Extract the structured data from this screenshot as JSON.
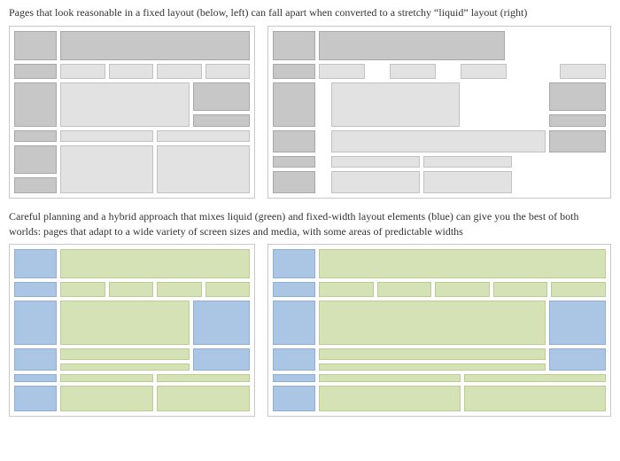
{
  "caption_top": "Pages that look reasonable in a fixed layout (below, left) can fall apart when converted to a stretchy “liquid” layout (right)",
  "caption_bottom": "Careful planning and a hybrid approach that mixes liquid (green) and fixed-width layout elements (blue) can give you the best of both worlds: pages that adapt to a wide variety of screen sizes and media, with some areas of predictable widths",
  "colors": {
    "grey_dark": "#c7c7c7",
    "grey_light": "#e2e2e2",
    "blue": "#aac6e4",
    "green": "#d5e2b6",
    "panel_border": "#c8c8c8"
  },
  "chart_data": [
    {
      "id": "fixed-grey",
      "type": "layout-diagram",
      "title": "Fixed layout (grey)",
      "width_class": "narrow",
      "rows": [
        [
          {
            "c": "gd",
            "w": 1
          },
          {
            "c": "gd",
            "w": 4
          }
        ],
        [
          {
            "c": "gd",
            "w": 1.2
          },
          {
            "c": "gl",
            "w": 1
          },
          {
            "c": "gl",
            "w": 1
          },
          {
            "c": "gl",
            "w": 1
          },
          {
            "c": "gl",
            "w": 1
          }
        ],
        [
          {
            "c": "gd",
            "w": 1.2
          },
          {
            "c": "gl",
            "w": 3,
            "h": "tall"
          },
          {
            "c": "gd",
            "w": 1.5,
            "h": "tall"
          }
        ],
        [
          {
            "c": "gd",
            "w": 1.2
          },
          {
            "c": "gl",
            "w": 3
          },
          {
            "c": "gd",
            "w": 1.5
          }
        ],
        [
          {
            "c": "gd",
            "w": 1.2
          },
          {
            "c": "gl",
            "w": 2
          },
          {
            "c": "gl",
            "w": 2
          }
        ],
        [
          {
            "c": "gd",
            "w": 1.2
          },
          {
            "c": "gl",
            "w": 2,
            "h": "tall"
          },
          {
            "c": "gl",
            "w": 2,
            "h": "tall"
          }
        ]
      ]
    },
    {
      "id": "liquid-grey",
      "type": "layout-diagram",
      "title": "Liquid layout falling apart (grey)",
      "width_class": "wide",
      "rows": [
        [
          {
            "c": "gd",
            "w": 1
          },
          {
            "c": "gd",
            "w": 4
          },
          {
            "c": "wh",
            "w": 1.5
          }
        ],
        [
          {
            "c": "gd",
            "w": 1
          },
          {
            "c": "gl",
            "w": 1
          },
          {
            "c": "wh",
            "w": 0.6
          },
          {
            "c": "gl",
            "w": 1
          },
          {
            "c": "wh",
            "w": 0.6
          },
          {
            "c": "gl",
            "w": 1
          },
          {
            "c": "wh",
            "w": 0.6
          },
          {
            "c": "gl",
            "w": 1
          }
        ],
        [
          {
            "c": "gd",
            "w": 1
          },
          {
            "c": "wh",
            "w": 0.3
          },
          {
            "c": "gl",
            "w": 3,
            "h": "tall"
          },
          {
            "c": "wh",
            "w": 2.3
          },
          {
            "c": "gd",
            "w": 1.5,
            "h": "tall"
          }
        ],
        [
          {
            "c": "gd",
            "w": 1
          },
          {
            "c": "wh",
            "w": 0.3
          },
          {
            "c": "gl",
            "w": 5
          },
          {
            "c": "gd",
            "w": 1.5
          }
        ],
        [
          {
            "c": "gd",
            "w": 1
          },
          {
            "c": "wh",
            "w": 0.3
          },
          {
            "c": "gl",
            "w": 2
          },
          {
            "c": "gl",
            "w": 2
          },
          {
            "c": "wh",
            "w": 2.3
          }
        ],
        [
          {
            "c": "gd",
            "w": 1
          },
          {
            "c": "wh",
            "w": 0.3
          },
          {
            "c": "gl",
            "w": 2
          },
          {
            "c": "gl",
            "w": 2
          },
          {
            "c": "wh",
            "w": 2.3
          }
        ]
      ]
    },
    {
      "id": "hybrid-narrow",
      "type": "layout-diagram",
      "title": "Hybrid layout narrow (blue fixed, green liquid)",
      "width_class": "narrow",
      "rows": [
        [
          {
            "c": "bl",
            "w": 1
          },
          {
            "c": "gr",
            "w": 4
          }
        ],
        [
          {
            "c": "bl",
            "w": 1
          },
          {
            "c": "gr",
            "w": 1
          },
          {
            "c": "gr",
            "w": 1
          },
          {
            "c": "gr",
            "w": 1
          },
          {
            "c": "gr",
            "w": 1
          }
        ],
        [
          {
            "c": "bl",
            "w": 1
          },
          {
            "c": "gr",
            "w": 2.5,
            "h": "tall"
          },
          {
            "c": "bl",
            "w": 1.5,
            "h": "tall"
          }
        ],
        [
          {
            "c": "bl",
            "w": 1
          },
          {
            "c": "gr",
            "w": 2.5
          },
          {
            "c": "bl",
            "w": 1.5
          }
        ],
        [
          {
            "c": "bl",
            "w": 1
          },
          {
            "c": "gr",
            "w": 2
          },
          {
            "c": "gr",
            "w": 2
          }
        ],
        [
          {
            "c": "bl",
            "w": 1
          },
          {
            "c": "gr",
            "w": 2
          },
          {
            "c": "gr",
            "w": 2
          }
        ]
      ]
    },
    {
      "id": "hybrid-wide",
      "type": "layout-diagram",
      "title": "Hybrid layout wide (blue fixed, green liquid)",
      "width_class": "wide",
      "rows": [
        [
          {
            "c": "bl",
            "w": 1
          },
          {
            "c": "gr",
            "w": 6
          }
        ],
        [
          {
            "c": "bl",
            "w": 1
          },
          {
            "c": "gr",
            "w": 1
          },
          {
            "c": "gr",
            "w": 1
          },
          {
            "c": "gr",
            "w": 1
          },
          {
            "c": "gr",
            "w": 1
          },
          {
            "c": "gr",
            "w": 1
          }
        ],
        [
          {
            "c": "bl",
            "w": 1
          },
          {
            "c": "gr",
            "w": 4.5,
            "h": "tall"
          },
          {
            "c": "bl",
            "w": 1.5,
            "h": "tall"
          }
        ],
        [
          {
            "c": "bl",
            "w": 1
          },
          {
            "c": "gr",
            "w": 4.5
          },
          {
            "c": "bl",
            "w": 1.5
          }
        ],
        [
          {
            "c": "bl",
            "w": 1
          },
          {
            "c": "gr",
            "w": 3
          },
          {
            "c": "gr",
            "w": 3
          }
        ],
        [
          {
            "c": "bl",
            "w": 1
          },
          {
            "c": "gr",
            "w": 3
          },
          {
            "c": "gr",
            "w": 3
          }
        ]
      ]
    }
  ]
}
